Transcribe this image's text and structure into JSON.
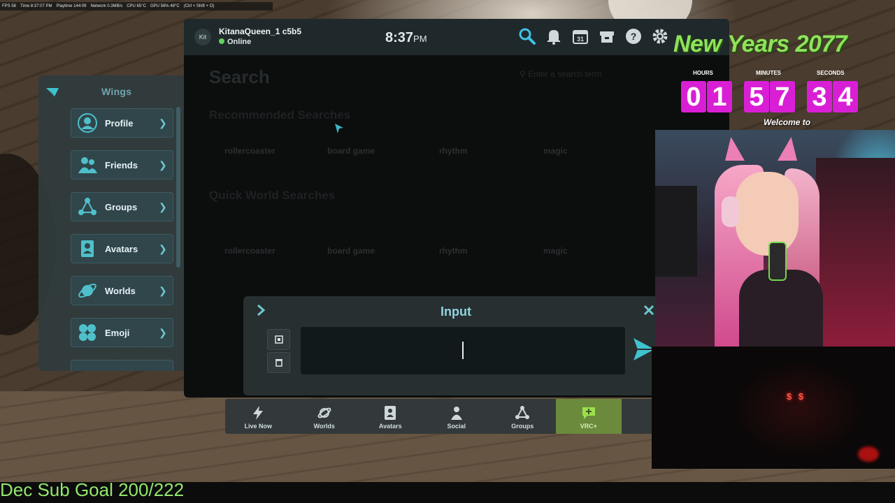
{
  "stats_bar": {
    "items": [
      "FPS 58",
      "Time 8:37:07 PM",
      "Playtime 144:09",
      "Network 0.3MB/s",
      "CPU 65°C",
      "GPU 56% 48°C",
      "(Ctrl + Shift + O)"
    ]
  },
  "wing": {
    "title": "Wings",
    "items": [
      {
        "label": "Profile",
        "icon": "profile-icon"
      },
      {
        "label": "Friends",
        "icon": "friends-icon"
      },
      {
        "label": "Groups",
        "icon": "groups-icon"
      },
      {
        "label": "Avatars",
        "icon": "avatars-icon"
      },
      {
        "label": "Worlds",
        "icon": "worlds-icon"
      },
      {
        "label": "Emoji",
        "icon": "emoji-icon"
      }
    ]
  },
  "header": {
    "kit_badge": "Kit",
    "username": "KitanaQueen_1 c5b5",
    "status": "Online",
    "time": "8:37",
    "time_suffix": "PM"
  },
  "search": {
    "title": "Search",
    "placeholder": "Enter a search term",
    "recommended_title": "Recommended Searches",
    "quick_title": "Quick World Searches",
    "recommended_tags": [
      "rollercoaster",
      "board game",
      "rhythm",
      "magic"
    ],
    "quick_tags": [
      "rollercoaster",
      "board game",
      "rhythm",
      "magic"
    ]
  },
  "bottom_bar": {
    "items": [
      {
        "label": "Live Now",
        "icon": "lightning-icon"
      },
      {
        "label": "Worlds",
        "icon": "planet-icon"
      },
      {
        "label": "Avatars",
        "icon": "avatar-card-icon"
      },
      {
        "label": "Social",
        "icon": "social-icon"
      },
      {
        "label": "Groups",
        "icon": "groups-icon"
      },
      {
        "label": "VRC+",
        "icon": "vrc-plus-icon",
        "active": true
      }
    ]
  },
  "input_dialog": {
    "title": "Input",
    "value": ""
  },
  "countdown": {
    "title": "New Years 2077",
    "labels": {
      "hours": "HOURS",
      "minutes": "MINUTES",
      "seconds": "SECONDS"
    },
    "digits": [
      "0",
      "1",
      "5",
      "7",
      "3",
      "4"
    ],
    "welcome": "Welcome to"
  },
  "overlay": {
    "sub_goal": "Dec Sub Goal 200/222"
  },
  "colors": {
    "accent": "#6fc7cf",
    "countdown_digit": "#d91fd6",
    "goal_text": "#92e86c",
    "online": "#5fd35f"
  }
}
